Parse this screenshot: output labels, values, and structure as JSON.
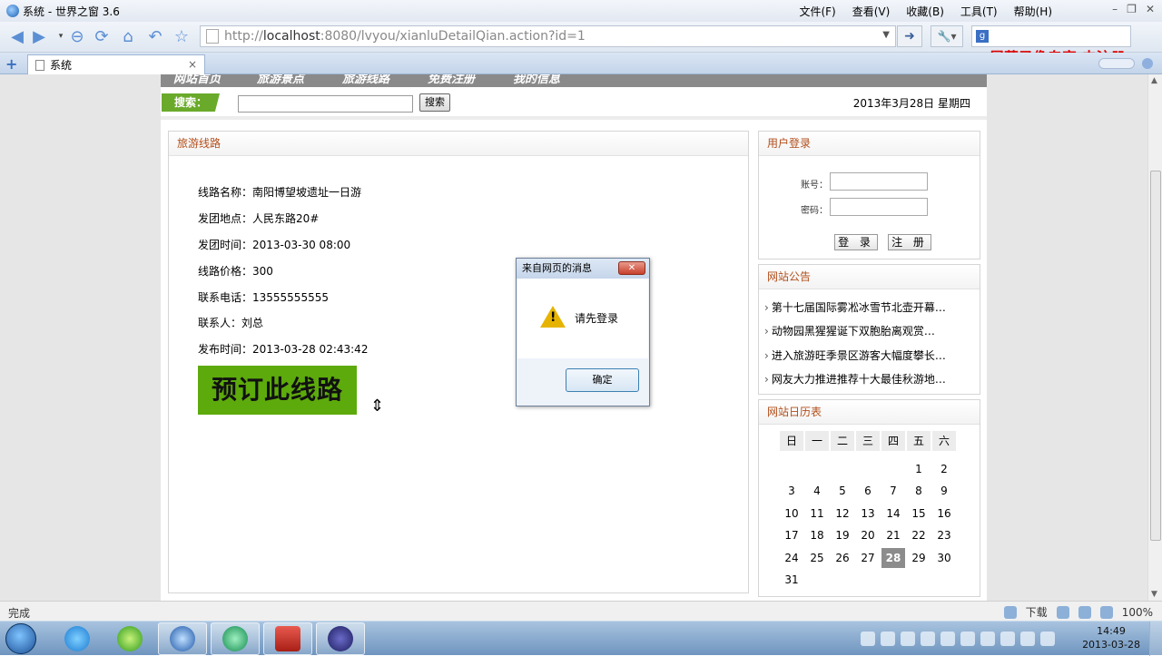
{
  "window": {
    "title": "系统 - 世界之窗 3.6",
    "menu": [
      "文件(F)",
      "查看(V)",
      "收藏(B)",
      "工具(T)",
      "帮助(H)"
    ]
  },
  "address": {
    "prefix": "http://",
    "host": "localhost",
    "rest": ":8080/lvyou/xianluDetailQian.action?id=1"
  },
  "watermark": "屏幕录像专家  未注册",
  "tab": {
    "label": "系统",
    "close": "×"
  },
  "site": {
    "nav": [
      "网站首页",
      "旅游景点",
      "旅游线路",
      "免费注册",
      "我的信息"
    ],
    "search_label": "搜索：",
    "search_button": "搜索",
    "date": "2013年3月28日 星期四"
  },
  "route": {
    "heading": "旅游线路",
    "fields": [
      "线路名称：南阳博望坡遗址一日游",
      "发团地点：人民东路20#",
      "发团时间：2013-03-30 08:00",
      "线路价格：300",
      "联系电话：13555555555",
      "联系人：刘总",
      "发布时间：2013-03-28 02:43:42"
    ],
    "book_button": "预订此线路"
  },
  "login": {
    "heading": "用户登录",
    "user_label": "账号：",
    "pass_label": "密码：",
    "login_btn": "登 录",
    "register_btn": "注 册"
  },
  "notices": {
    "heading": "网站公告",
    "items": [
      "第十七届国际雾凇冰雪节北壶开幕…",
      "动物园黑猩猩诞下双胞胎离观赏…",
      "进入旅游旺季景区游客大幅度攀长…",
      "网友大力推进推荐十大最佳秋游地…"
    ]
  },
  "calendar": {
    "heading": "网站日历表",
    "weekdays": [
      "日",
      "一",
      "二",
      "三",
      "四",
      "五",
      "六"
    ],
    "rows": [
      [
        "",
        "",
        "",
        "",
        "",
        "1",
        "2"
      ],
      [
        "3",
        "4",
        "5",
        "6",
        "7",
        "8",
        "9"
      ],
      [
        "10",
        "11",
        "12",
        "13",
        "14",
        "15",
        "16"
      ],
      [
        "17",
        "18",
        "19",
        "20",
        "21",
        "22",
        "23"
      ],
      [
        "24",
        "25",
        "26",
        "27",
        "28",
        "29",
        "30"
      ],
      [
        "31",
        "",
        "",
        "",
        "",
        "",
        ""
      ]
    ],
    "today": "28"
  },
  "dialog": {
    "title": "来自网页的消息",
    "message": "请先登录",
    "ok": "确定",
    "close": "✕"
  },
  "status": {
    "text": "完成",
    "download": "下载",
    "zoom": "100%"
  },
  "clock": {
    "time": "14:49",
    "date": "2013-03-28"
  }
}
